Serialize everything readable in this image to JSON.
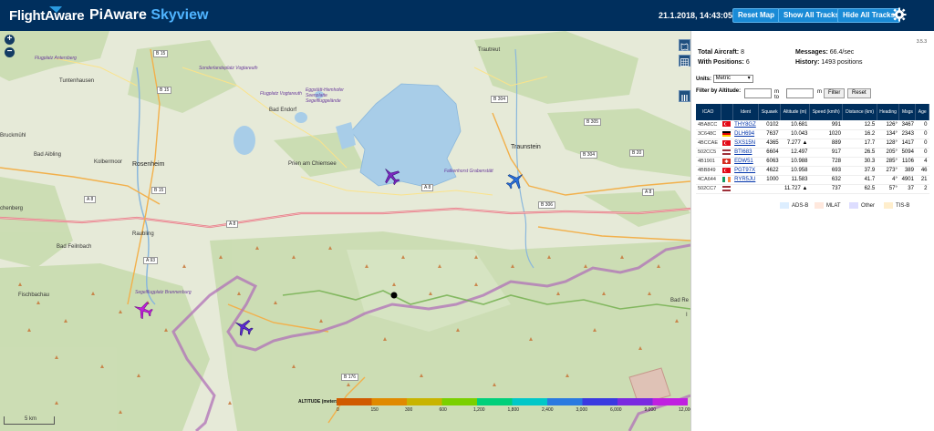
{
  "header": {
    "logo_text": "FlightAware",
    "brand_part1": "PiAware",
    "brand_part2": "Skyview",
    "clock": "21.1.2018, 14:43:05",
    "buttons": {
      "reset_map": "Reset Map",
      "show_all": "Show All Tracks",
      "hide_all": "Hide All Tracks"
    },
    "icons": {
      "settings": "gear-icon"
    },
    "colors": {
      "bar": "#002f5d",
      "accent": "#4fb4ff",
      "button": "#1a8bd6"
    }
  },
  "map": {
    "places": {
      "flugplatz_antersberg": "Flugplatz Antersberg",
      "tuntenhausen": "Tuntenhausen",
      "sonderlandeplatz": "Sonderlandeplatz Vogtareuth",
      "flugplatz_vogtareuth": "Flugplatz Vogtareuth",
      "eggstaett": "Eggstätt-Hemhofer Seenplatte Segelfluggelände",
      "bad_endorf": "Bad Endorf",
      "truchtlaching": "Trautreut",
      "ruckmuhl": "Bruckmühl",
      "bad_aibling": "Bad Aibling",
      "kolbermoor": "Kolbermoor",
      "rosenheim": "Rosenheim",
      "prien": "Prien am Chiemsee",
      "traunstein": "Traunstein",
      "falkenhorst": "Falkenhorst Grabenstätt",
      "raubling": "Raubling",
      "bad_feilnbach": "Bad Feilnbach",
      "fischbachau": "Fischbachau",
      "segelflugplatz": "Segelflugplatz Brannenburg",
      "ebenberg": "chenberg",
      "bad_re": "Bad Re",
      "i_mark": "I"
    },
    "road_labels": [
      "B 15",
      "B 15",
      "B 15",
      "B 304",
      "B 304",
      "A 8",
      "A 8",
      "A 8",
      "A 8",
      "A 93",
      "B 306",
      "B 176",
      "B 20",
      "B 305"
    ],
    "zoom_in": "+",
    "zoom_out": "−",
    "scale_label": "5 km",
    "icons": {
      "layers": "map-layers-icon",
      "table": "table-icon",
      "panel": "panel-toggle-icon"
    }
  },
  "altitude_legend": {
    "title": "ALTITUDE (meters)",
    "ticks": [
      "0",
      "150",
      "300",
      "600",
      "1,200",
      "1,800",
      "2,400",
      "3,000",
      "6,000",
      "9,000",
      "12,000"
    ],
    "colors": [
      "#d05a00",
      "#e08a00",
      "#c8b400",
      "#7ad000",
      "#00d07a",
      "#00c8c8",
      "#2a7ae0",
      "#3a3ae0",
      "#7a2ae0",
      "#c020e0"
    ]
  },
  "sidebar": {
    "version": "3.5.3",
    "total_label": "Total Aircraft:",
    "total_value": "8",
    "positions_label": "With Positions:",
    "positions_value": "6",
    "messages_label": "Messages:",
    "messages_value": "66.4/sec",
    "history_label": "History:",
    "history_value": "1493 positions",
    "units_label": "Units:",
    "units_value": "Metric",
    "filter_label": "Filter by Altitude:",
    "filter_from_unit": "m to",
    "filter_to_unit": "m",
    "filter_button": "Filter",
    "reset_button": "Reset",
    "table_headers": [
      "ICAO",
      "",
      "Ident",
      "Squawk",
      "Altitude (m)",
      "Speed (km/h)",
      "Distance (km)",
      "Heading",
      "Msgs",
      "Age"
    ],
    "rows": [
      {
        "icao": "4BA8CC",
        "flag": "tr",
        "ident": "THY8GZ",
        "squawk": "0102",
        "altitude": "10.681",
        "speed": "991",
        "distance": "12.5",
        "heading": "126°",
        "msgs": "3467",
        "age": "0",
        "src": "adsb"
      },
      {
        "icao": "3C648C",
        "flag": "de",
        "ident": "DLH694",
        "squawk": "7637",
        "altitude": "10.043",
        "speed": "1020",
        "distance": "16.2",
        "heading": "134°",
        "msgs": "2343",
        "age": "0",
        "src": "adsb"
      },
      {
        "icao": "4BCCAE",
        "flag": "tr",
        "ident": "SXS15N",
        "squawk": "4365",
        "altitude": "7.277 ▲",
        "speed": "889",
        "distance": "17.7",
        "heading": "128°",
        "msgs": "1417",
        "age": "0",
        "src": "adsb"
      },
      {
        "icao": "502CC5",
        "flag": "lv",
        "ident": "BTI683",
        "squawk": "6604",
        "altitude": "12.497",
        "speed": "917",
        "distance": "26.5",
        "heading": "205°",
        "msgs": "5094",
        "age": "0",
        "src": "adsb"
      },
      {
        "icao": "4B1901",
        "flag": "ch",
        "ident": "EDW51",
        "squawk": "6063",
        "altitude": "10.988",
        "speed": "728",
        "distance": "30.3",
        "heading": "285°",
        "msgs": "1106",
        "age": "4",
        "src": "adsb"
      },
      {
        "icao": "4BB849",
        "flag": "tr",
        "ident": "PGT97X",
        "squawk": "4622",
        "altitude": "10.958",
        "speed": "693",
        "distance": "37.9",
        "heading": "273°",
        "msgs": "389",
        "age": "46",
        "src": "adsb"
      },
      {
        "icao": "4CA644",
        "flag": "ie",
        "ident": "RYR5JU",
        "squawk": "1000",
        "altitude": "11.583",
        "speed": "632",
        "distance": "41.7",
        "heading": "4°",
        "msgs": "4901",
        "age": "21",
        "src": "adsb"
      },
      {
        "icao": "502CC7",
        "flag": "lv",
        "ident": "",
        "squawk": "",
        "altitude": "11.727 ▲",
        "speed": "737",
        "distance": "62.5",
        "heading": "57°",
        "msgs": "37",
        "age": "2",
        "src": "mlat"
      }
    ],
    "source_legend": [
      {
        "label": "ADS-B",
        "color": "#ddeeff"
      },
      {
        "label": "MLAT",
        "color": "#ffe8dd"
      },
      {
        "label": "Other",
        "color": "#ddddff"
      },
      {
        "label": "TIS-B",
        "color": "#ffeecc"
      }
    ]
  }
}
